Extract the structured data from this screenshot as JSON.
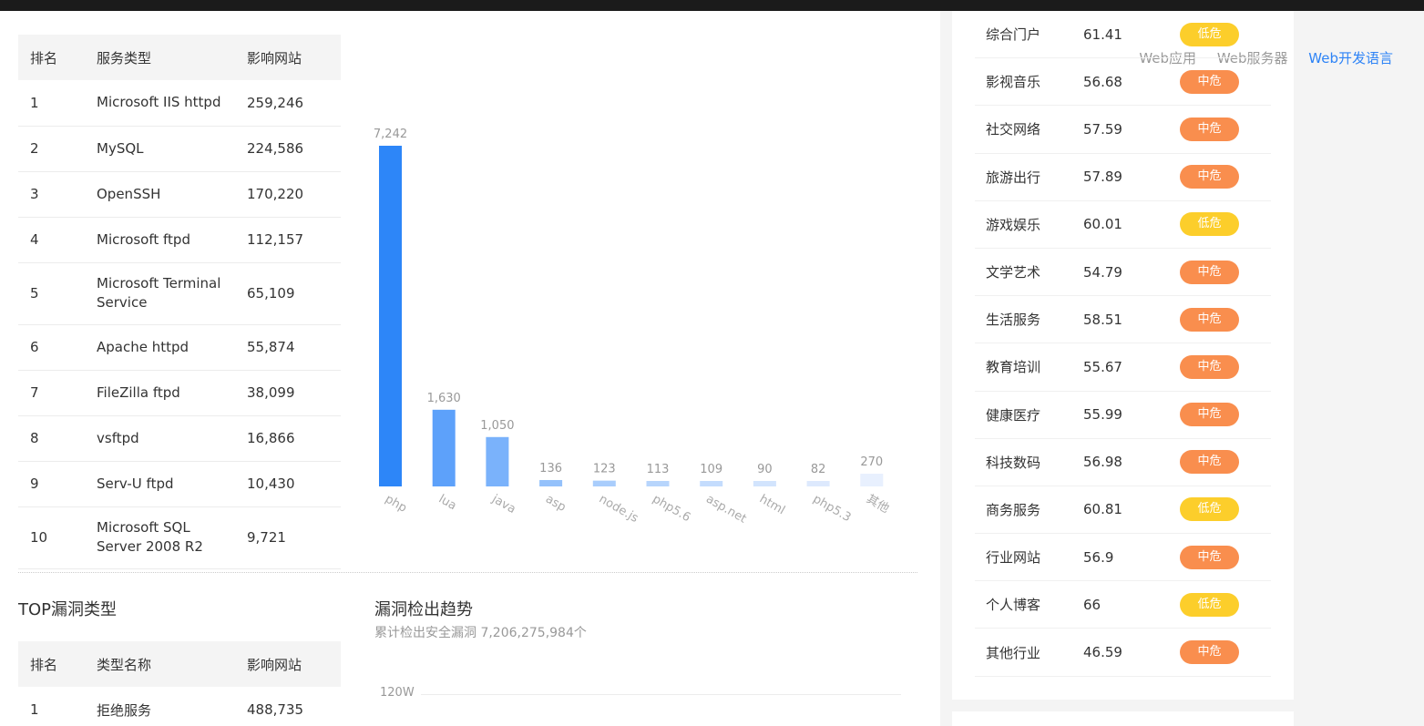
{
  "service_table": {
    "headers": [
      "排名",
      "服务类型",
      "影响网站"
    ],
    "rows": [
      [
        "1",
        "Microsoft IIS httpd",
        "259,246"
      ],
      [
        "2",
        "MySQL",
        "224,586"
      ],
      [
        "3",
        "OpenSSH",
        "170,220"
      ],
      [
        "4",
        "Microsoft ftpd",
        "112,157"
      ],
      [
        "5",
        "Microsoft Terminal Service",
        "65,109"
      ],
      [
        "6",
        "Apache httpd",
        "55,874"
      ],
      [
        "7",
        "FileZilla ftpd",
        "38,099"
      ],
      [
        "8",
        "vsftpd",
        "16,866"
      ],
      [
        "9",
        "Serv-U ftpd",
        "10,430"
      ],
      [
        "10",
        "Microsoft SQL Server 2008 R2",
        "9,721"
      ]
    ]
  },
  "tabs": [
    {
      "label": "Web应用",
      "active": false
    },
    {
      "label": "Web服务器",
      "active": false
    },
    {
      "label": "Web开发语言",
      "active": true
    }
  ],
  "chart_data": {
    "type": "bar",
    "categories": [
      "php",
      "lua",
      "java",
      "asp",
      "node.js",
      "php5.6",
      "asp.net",
      "html",
      "php5.3",
      "其他"
    ],
    "values": [
      7242,
      1630,
      1050,
      136,
      123,
      113,
      109,
      90,
      82,
      270
    ],
    "value_labels": [
      "7,242",
      "1,630",
      "1,050",
      "136",
      "123",
      "113",
      "109",
      "90",
      "82",
      "270"
    ],
    "colors": [
      "#2d86f8",
      "#5da1fa",
      "#7ab2fb",
      "#94c1fb",
      "#a9cdfc",
      "#b7d5fc",
      "#c4dcfd",
      "#d2e4fd",
      "#dde9fd",
      "#e8f0fe"
    ],
    "ylim": [
      0,
      7242
    ]
  },
  "vuln_section": {
    "title": "TOP漏洞类型",
    "headers": [
      "排名",
      "类型名称",
      "影响网站"
    ],
    "rows": [
      [
        "1",
        "拒绝服务",
        "488,735"
      ]
    ]
  },
  "trend": {
    "title": "漏洞检出趋势",
    "subtitle": "累计检出安全漏洞 7,206,275,984个",
    "y_tick": "120W"
  },
  "industries": [
    {
      "name": "综合门户",
      "score": "61.41",
      "level": "低危",
      "kind": "low"
    },
    {
      "name": "影视音乐",
      "score": "56.68",
      "level": "中危",
      "kind": "mid"
    },
    {
      "name": "社交网络",
      "score": "57.59",
      "level": "中危",
      "kind": "mid"
    },
    {
      "name": "旅游出行",
      "score": "57.89",
      "level": "中危",
      "kind": "mid"
    },
    {
      "name": "游戏娱乐",
      "score": "60.01",
      "level": "低危",
      "kind": "low"
    },
    {
      "name": "文学艺术",
      "score": "54.79",
      "level": "中危",
      "kind": "mid"
    },
    {
      "name": "生活服务",
      "score": "58.51",
      "level": "中危",
      "kind": "mid"
    },
    {
      "name": "教育培训",
      "score": "55.67",
      "level": "中危",
      "kind": "mid"
    },
    {
      "name": "健康医疗",
      "score": "55.99",
      "level": "中危",
      "kind": "mid"
    },
    {
      "name": "科技数码",
      "score": "56.98",
      "level": "中危",
      "kind": "mid"
    },
    {
      "name": "商务服务",
      "score": "60.81",
      "level": "低危",
      "kind": "low"
    },
    {
      "name": "行业网站",
      "score": "56.9",
      "level": "中危",
      "kind": "mid"
    },
    {
      "name": "个人博客",
      "score": "66",
      "level": "低危",
      "kind": "low"
    },
    {
      "name": "其他行业",
      "score": "46.59",
      "level": "中危",
      "kind": "mid"
    }
  ]
}
